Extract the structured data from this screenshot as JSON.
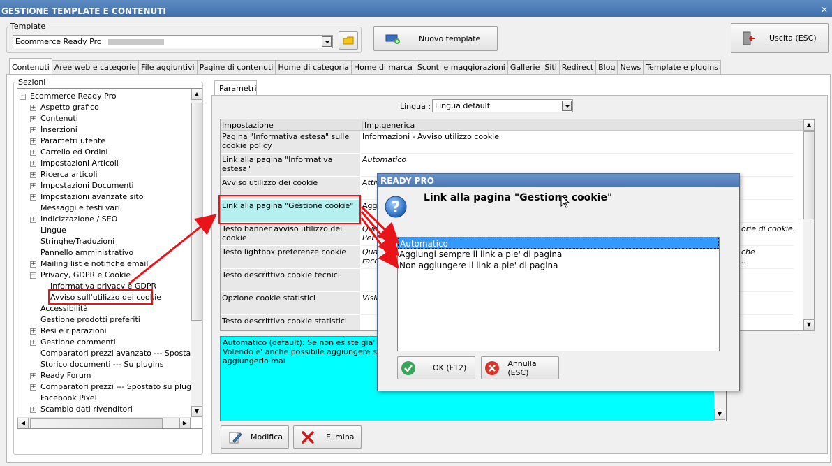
{
  "window": {
    "title": "GESTIONE TEMPLATE E CONTENUTI",
    "close_glyph": "✕"
  },
  "template": {
    "label": "Template",
    "selected": "Ecommerce Ready Pro",
    "open_icon": "folder-icon"
  },
  "toolbar": {
    "new_template_label": "Nuovo template",
    "exit_label": "Uscita (ESC)"
  },
  "tabs": [
    "Contenuti",
    "Aree web e categorie",
    "File aggiuntivi",
    "Pagine di contenuti",
    "Home di categoria",
    "Home di marca",
    "Sconti e maggiorazioni",
    "Gallerie",
    "Siti",
    "Redirect",
    "Blog",
    "News",
    "Template e plugins"
  ],
  "sections": {
    "label": "Sezioni",
    "root": "Ecommerce Ready Pro",
    "items": [
      {
        "label": "Aspetto grafico",
        "expandable": true,
        "level": 1
      },
      {
        "label": "Contenuti",
        "expandable": true,
        "level": 1
      },
      {
        "label": "Inserzioni",
        "expandable": true,
        "level": 1
      },
      {
        "label": "Parametri utente",
        "expandable": true,
        "level": 1
      },
      {
        "label": "Carrello ed Ordini",
        "expandable": true,
        "level": 1
      },
      {
        "label": "Impostazioni Articoli",
        "expandable": true,
        "level": 1
      },
      {
        "label": "Ricerca articoli",
        "expandable": true,
        "level": 1
      },
      {
        "label": "Impostazioni Documenti",
        "expandable": true,
        "level": 1
      },
      {
        "label": "Impostazioni avanzate sito",
        "expandable": true,
        "level": 1
      },
      {
        "label": "Messaggi e testi vari",
        "expandable": false,
        "level": 1
      },
      {
        "label": "Indicizzazione / SEO",
        "expandable": true,
        "level": 1
      },
      {
        "label": "Lingue",
        "expandable": false,
        "level": 1
      },
      {
        "label": "Stringhe/Traduzioni",
        "expandable": false,
        "level": 1
      },
      {
        "label": "Pannello amministrativo",
        "expandable": false,
        "level": 1
      },
      {
        "label": "Mailing list e notifiche email",
        "expandable": true,
        "level": 1
      },
      {
        "label": "Privacy, GDPR e Cookie",
        "expandable": true,
        "expanded": true,
        "level": 1
      },
      {
        "label": "Informativa privacy e GDPR",
        "expandable": false,
        "level": 2
      },
      {
        "label": "Avviso sull'utilizzo dei cookie",
        "expandable": false,
        "level": 2,
        "highlighted": true
      },
      {
        "label": "Accessibilità",
        "expandable": false,
        "level": 1
      },
      {
        "label": "Gestione prodotti preferiti",
        "expandable": false,
        "level": 1
      },
      {
        "label": "Resi e riparazioni",
        "expandable": true,
        "level": 1
      },
      {
        "label": "Gestione commenti",
        "expandable": true,
        "level": 1
      },
      {
        "label": "Comparatori prezzi avanzato --- Spostato su",
        "expandable": false,
        "level": 1
      },
      {
        "label": "Storico documenti --- Su plugins",
        "expandable": false,
        "level": 1
      },
      {
        "label": "Ready Forum",
        "expandable": true,
        "level": 1
      },
      {
        "label": "Comparatori prezzi --- Spostato su plugins",
        "expandable": true,
        "level": 1
      },
      {
        "label": "Facebook Pixel",
        "expandable": false,
        "level": 1
      },
      {
        "label": "Scambio dati rivenditori",
        "expandable": true,
        "level": 1
      }
    ]
  },
  "parameters": {
    "tab_label": "Parametri",
    "language_label": "Lingua :",
    "language_value": "Lingua default",
    "col_setting": "Impostazione",
    "col_value": "Imp.generica",
    "rows": [
      {
        "setting": "Pagina \"Informativa estesa\" sulle cookie policy",
        "value": "Informazioni - Avviso utilizzo cookie",
        "italic": false
      },
      {
        "setting": "Link alla pagina \"Informativa estesa\"",
        "value": "Automatico",
        "italic": true
      },
      {
        "setting": "Avviso utilizzo dei cookie",
        "value": "Attiv",
        "italic": true
      },
      {
        "setting": "Link alla pagina \"Gestione cookie\"",
        "value": "Aggi",
        "italic": false,
        "highlighted": true
      },
      {
        "setting": "Testo banner avviso utilizzo dei cookie",
        "value": "Que",
        "value2": "Per",
        "tail": "orie di cookie.",
        "italic": true
      },
      {
        "setting": "Testo lightbox preferenze cookie",
        "value": "Qua",
        "value2": "racc",
        "tail": "che",
        "tail2": "..",
        "italic": true
      },
      {
        "setting": "Testo descrittivo cookie tecnici",
        "value": "",
        "italic": false
      },
      {
        "setting": "Opzione cookie statistici",
        "value": "Visib",
        "italic": true
      },
      {
        "setting": "Testo descrittivo cookie statistici",
        "value": "",
        "italic": false
      }
    ],
    "description": [
      "Automatico (default): Se non esiste gia' in pagi",
      "Volendo e' anche possibile aggiungere sempre",
      "aggiungerlo mai"
    ],
    "edit_label": "Modifica",
    "delete_label": "Elimina"
  },
  "dialog": {
    "title": "READY PRO",
    "heading": "Link alla pagina \"Gestione cookie\"",
    "options": [
      {
        "label": "Automatico",
        "selected": true
      },
      {
        "label": "Aggiungi sempre il link a pie' di pagina",
        "selected": false
      },
      {
        "label": "Non aggiungere il link a pie' di pagina",
        "selected": false
      }
    ],
    "ok_label": "OK (F12)",
    "cancel_label": "Annulla (ESC)"
  },
  "colors": {
    "annotation": "#e8141a",
    "selection": "#3399ff",
    "description_bg": "#00ffff",
    "highlight_cell": "#b4f0f0"
  }
}
